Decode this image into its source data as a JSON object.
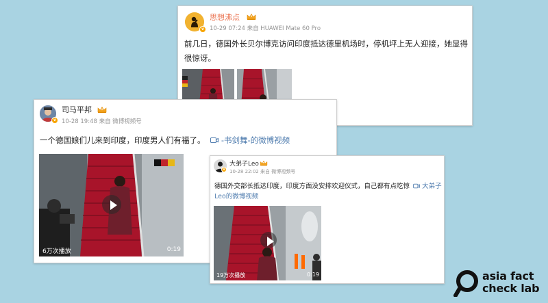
{
  "post1": {
    "user": "思想沸点",
    "meta": "10-29 07:24 来自 HUAWEI Mate 60 Pro",
    "text": "前几日，德国外长贝尔博克访问印度抵达德里机场时，停机坪上无人迎接，她显得很惊讶。"
  },
  "post2": {
    "user": "司马平邦",
    "meta": "10-28 19:48 来自 微博视频号",
    "text": "一个德国娘们儿来到印度，印度男人们有福了。",
    "video_link": "-书剑舞-的微博视频",
    "views": "6万次播放",
    "duration": "0:19"
  },
  "post3": {
    "user": "大弟子Leo",
    "meta": "10-28 22:02 来自 微博视频号",
    "text": "德国外交部长抵达印度，印度方面没安排欢迎仪式，自己都有点吃惊",
    "video_link": "大弟子Leo的微博视频",
    "views": "19万次播放",
    "duration": "0:19"
  },
  "logo": {
    "line1": "asia fact",
    "line2": "check lab"
  },
  "colors": {
    "background": "#a9d3e2",
    "username": "#eb7350",
    "link": "#507daf",
    "carpet": "#b3162b"
  }
}
